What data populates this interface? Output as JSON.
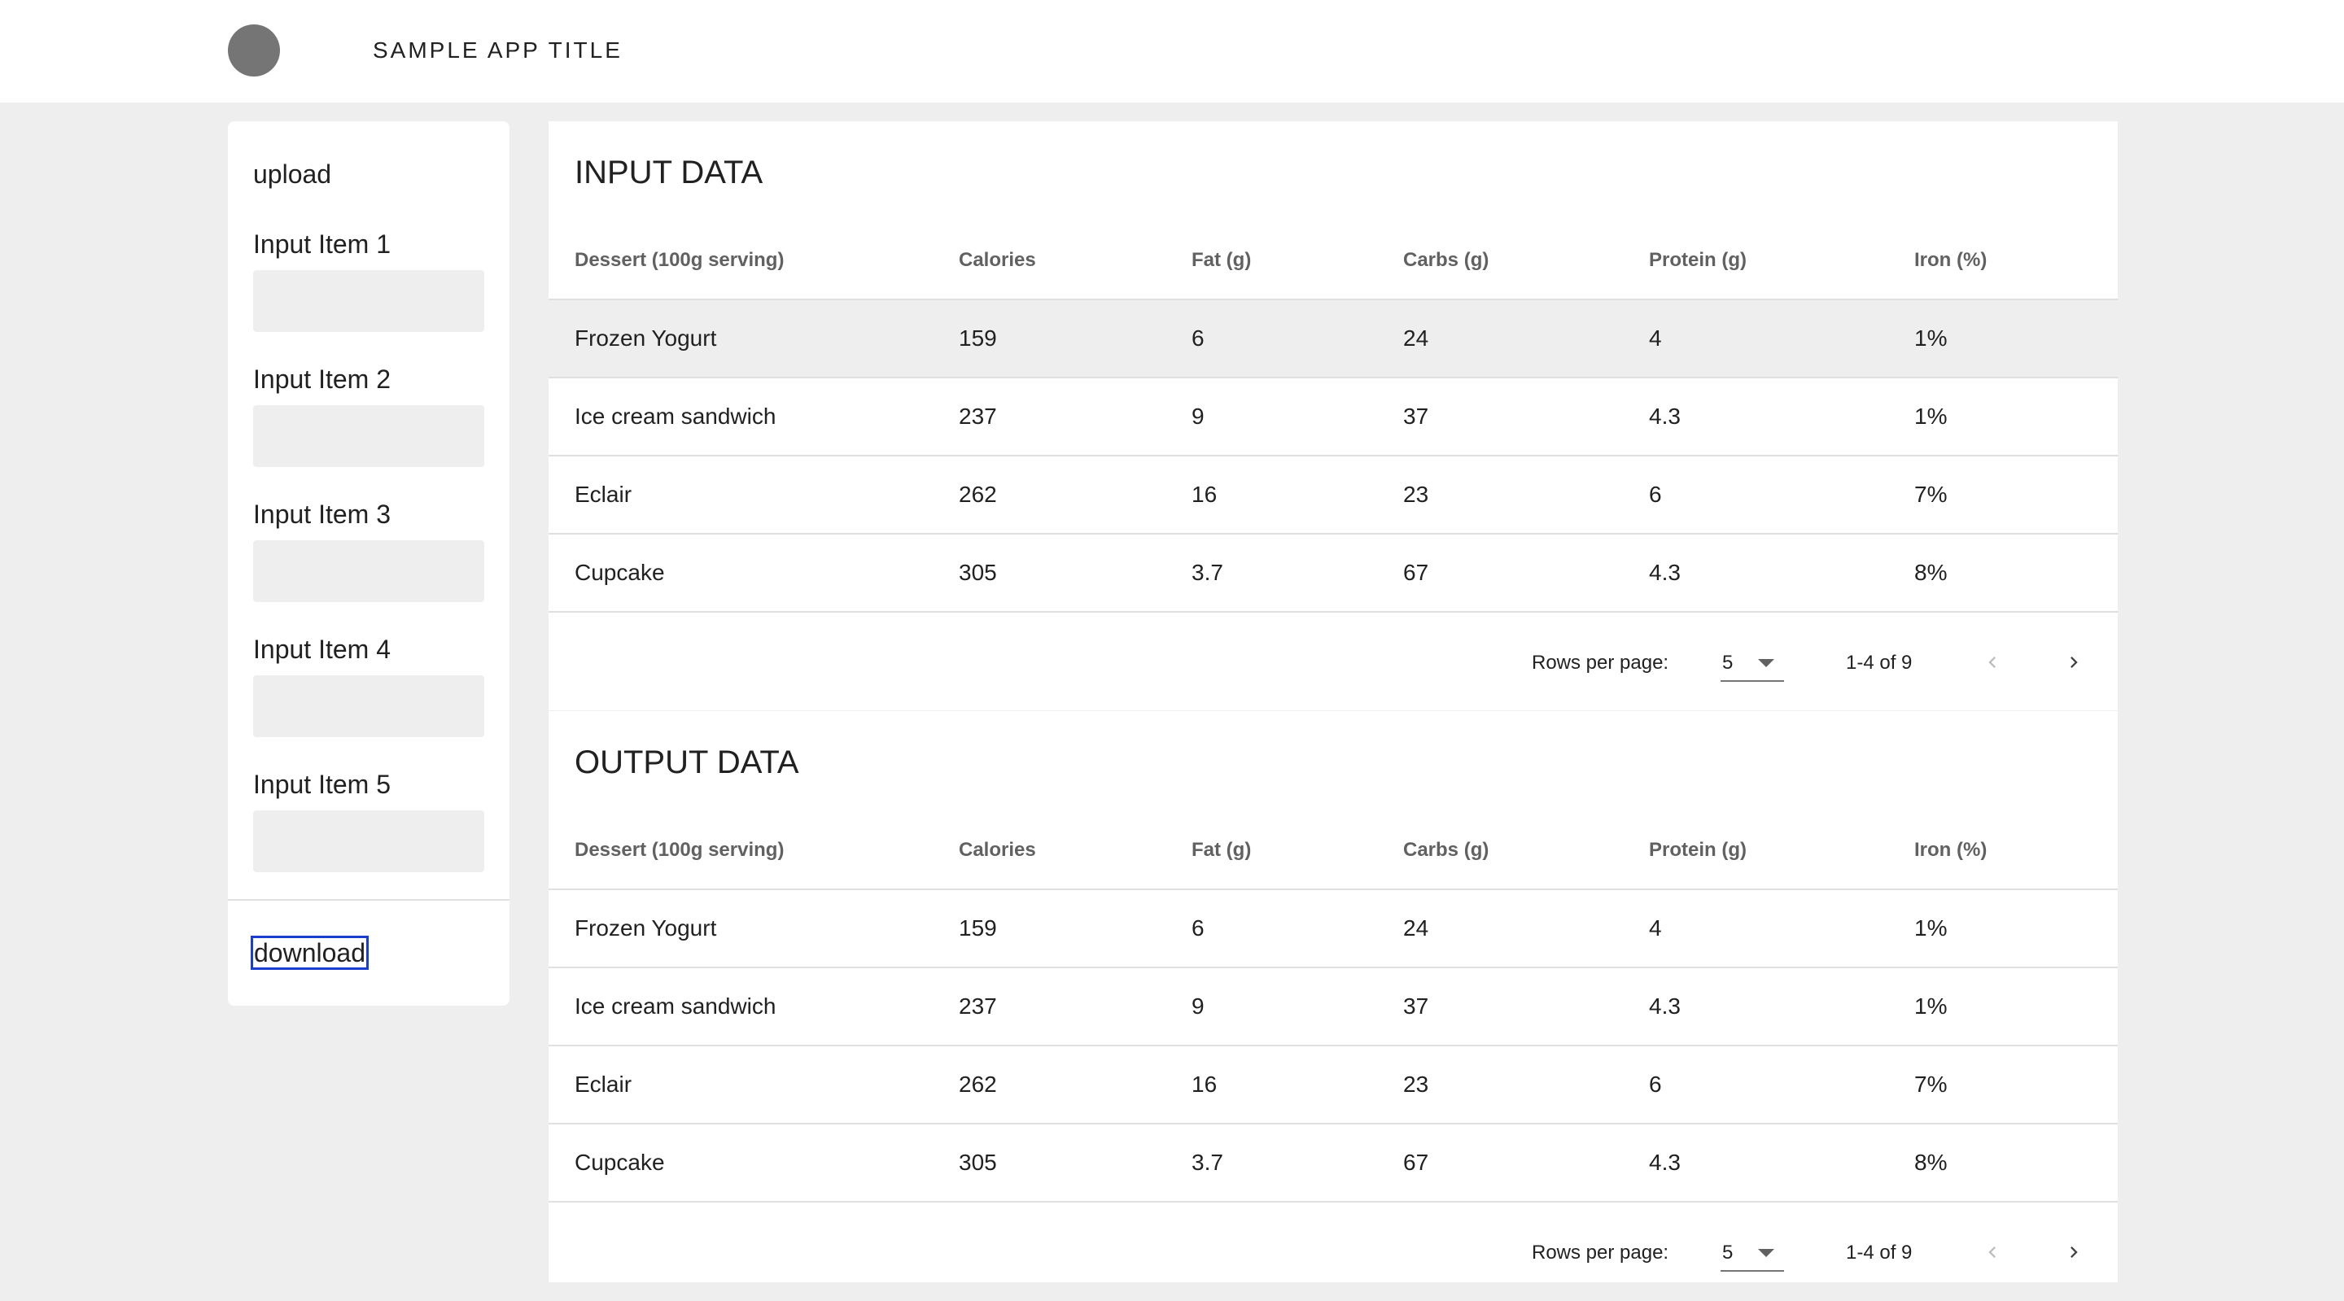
{
  "app": {
    "title": "SAMPLE APP TITLE"
  },
  "sidebar": {
    "upload_label": "upload",
    "inputs": [
      {
        "label": "Input Item 1",
        "value": ""
      },
      {
        "label": "Input Item 2",
        "value": ""
      },
      {
        "label": "Input Item 3",
        "value": ""
      },
      {
        "label": "Input Item 4",
        "value": ""
      },
      {
        "label": "Input Item 5",
        "value": ""
      }
    ],
    "download_label": "download"
  },
  "input_panel": {
    "title": "INPUT DATA",
    "columns": [
      "Dessert (100g serving)",
      "Calories",
      "Fat (g)",
      "Carbs (g)",
      "Protein (g)",
      "Iron (%)"
    ],
    "rows": [
      [
        "Frozen Yogurt",
        "159",
        "6",
        "24",
        "4",
        "1%"
      ],
      [
        "Ice cream sandwich",
        "237",
        "9",
        "37",
        "4.3",
        "1%"
      ],
      [
        "Eclair",
        "262",
        "16",
        "23",
        "6",
        "7%"
      ],
      [
        "Cupcake",
        "305",
        "3.7",
        "67",
        "4.3",
        "8%"
      ]
    ],
    "pager": {
      "rows_per_page_label": "Rows per page:",
      "rows_per_page": "5",
      "range": "1-4 of 9"
    }
  },
  "output_panel": {
    "title": "OUTPUT DATA",
    "columns": [
      "Dessert (100g serving)",
      "Calories",
      "Fat (g)",
      "Carbs (g)",
      "Protein (g)",
      "Iron (%)"
    ],
    "rows": [
      [
        "Frozen Yogurt",
        "159",
        "6",
        "24",
        "4",
        "1%"
      ],
      [
        "Ice cream sandwich",
        "237",
        "9",
        "37",
        "4.3",
        "1%"
      ],
      [
        "Eclair",
        "262",
        "16",
        "23",
        "6",
        "7%"
      ],
      [
        "Cupcake",
        "305",
        "3.7",
        "67",
        "4.3",
        "8%"
      ]
    ],
    "pager": {
      "rows_per_page_label": "Rows per page:",
      "rows_per_page": "5",
      "range": "1-4 of 9"
    }
  },
  "icons": {
    "logo": "app-logo",
    "dropdown": "caret-down-icon",
    "prev": "chevron-left-icon",
    "next": "chevron-right-icon"
  },
  "colors": {
    "appbar": "#ffffff",
    "background": "#eeeeee",
    "logo": "#757575",
    "focus_outline": "#1a3fcf",
    "hover_row": "#eeeeee"
  }
}
